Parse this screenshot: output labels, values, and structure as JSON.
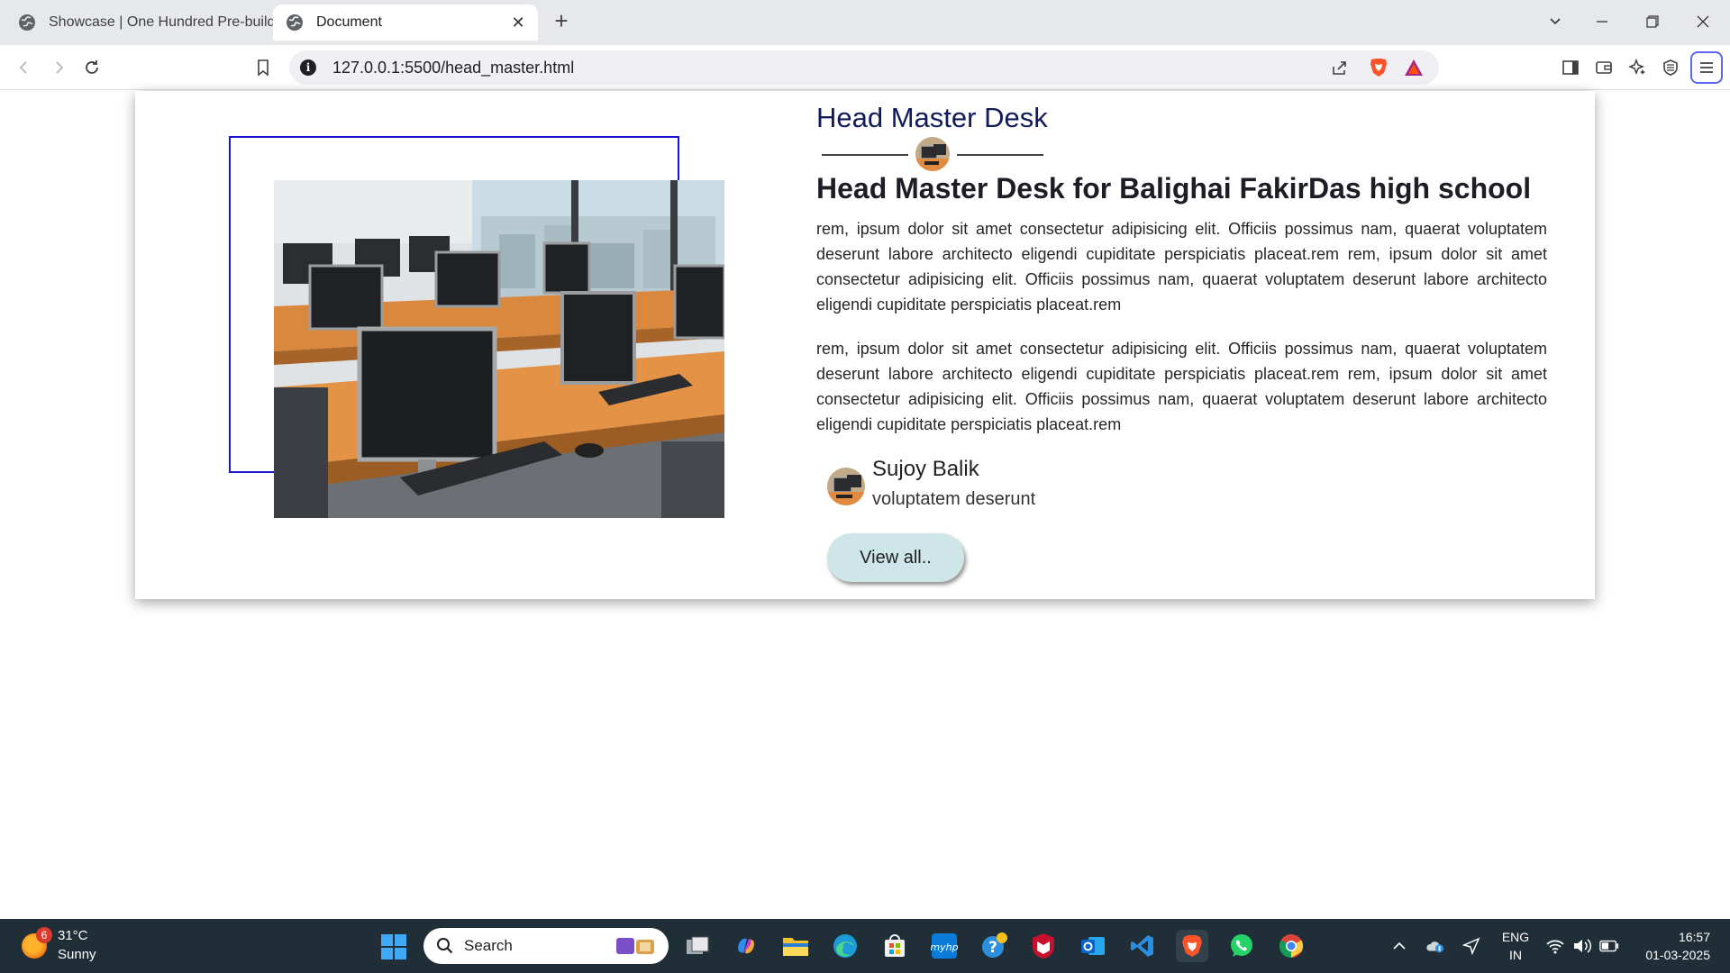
{
  "browser": {
    "tabs": [
      {
        "title": "Showcase | One Hundred Pre-build"
      },
      {
        "title": "Document"
      }
    ],
    "url": "127.0.0.1:5500/head_master.html"
  },
  "page": {
    "section_title": "Head Master Desk",
    "headline": "Head Master Desk for Balighai FakirDas high school",
    "paragraphs": [
      "rem, ipsum dolor sit amet consectetur adipisicing elit. Officiis possimus nam, quaerat voluptatem deserunt labore architecto eligendi cupiditate perspiciatis placeat.rem rem, ipsum dolor sit amet consectetur adipisicing elit. Officiis possimus nam, quaerat voluptatem deserunt labore architecto eligendi cupiditate perspiciatis placeat.rem",
      "rem, ipsum dolor sit amet consectetur adipisicing elit. Officiis possimus nam, quaerat voluptatem deserunt labore architecto eligendi cupiditate perspiciatis placeat.rem rem, ipsum dolor sit amet consectetur adipisicing elit. Officiis possimus nam, quaerat voluptatem deserunt labore architecto eligendi cupiditate perspiciatis placeat.rem"
    ],
    "author": {
      "name": "Sujoy Balik",
      "role": "voluptatem deserunt"
    },
    "view_all_label": "View all..",
    "colors": {
      "frame_border": "#1c18c9",
      "title": "#111a5c",
      "button_bg": "#cfe6e8"
    }
  },
  "taskbar": {
    "weather": {
      "badge": "6",
      "temp": "31°C",
      "condition": "Sunny"
    },
    "search_label": "Search",
    "language": {
      "line1": "ENG",
      "line2": "IN"
    },
    "clock": {
      "time": "16:57",
      "date": "01-03-2025"
    }
  }
}
